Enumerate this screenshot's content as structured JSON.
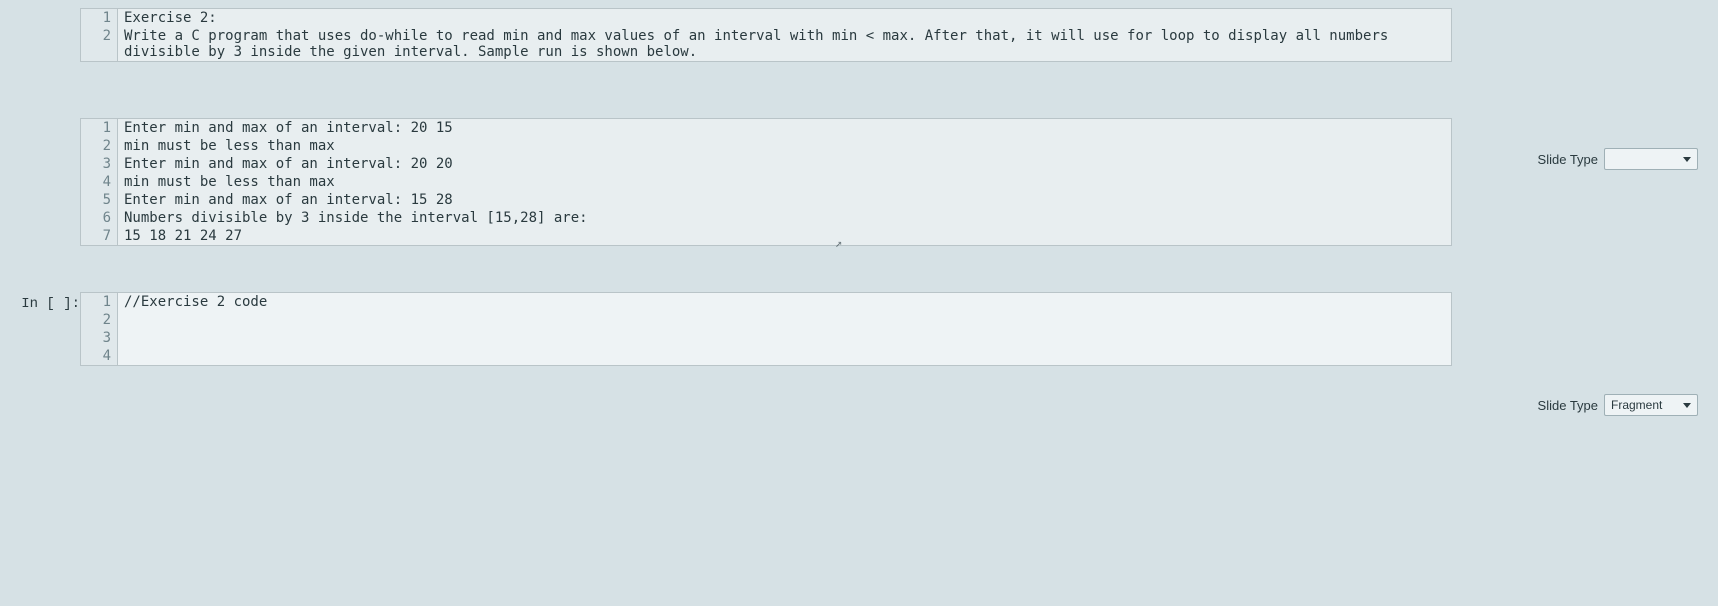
{
  "top_cell": {
    "lines": [
      "Exercise 2:",
      "Write a C program that uses do-while to read min and max values of an interval with min < max. After that, it will use for loop to display all numbers divisible by 3 inside the given interval. Sample run is shown below."
    ]
  },
  "mid_toolbar": {
    "label": "Slide Type",
    "selected": ""
  },
  "mid_cell": {
    "lines": [
      "Enter min and max of an interval: 20 15",
      "min must be less than max",
      "Enter min and max of an interval: 20 20",
      "min must be less than max",
      "Enter min and max of an interval: 15 28",
      "Numbers divisible by 3 inside the interval [15,28] are:",
      "15 18 21 24 27"
    ]
  },
  "bot_toolbar": {
    "label": "Slide Type",
    "selected": "Fragment"
  },
  "bot_prompt": "In [ ]:",
  "bot_cell": {
    "lines": [
      "//Exercise 2 code",
      "",
      "",
      ""
    ]
  },
  "line_numbers": {
    "top": [
      "1",
      "2"
    ],
    "mid": [
      "1",
      "2",
      "3",
      "4",
      "5",
      "6",
      "7"
    ],
    "bot": [
      "1",
      "2",
      "3",
      "4"
    ]
  }
}
